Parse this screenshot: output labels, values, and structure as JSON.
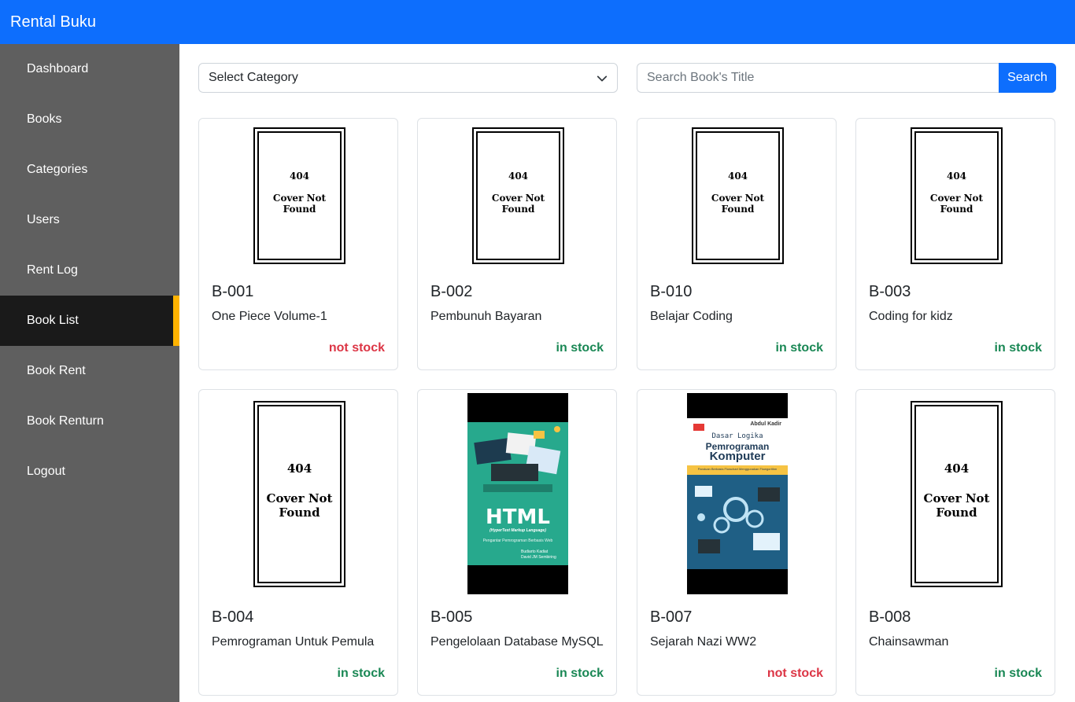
{
  "app": {
    "brand": "Rental Buku"
  },
  "sidebar": {
    "items": [
      {
        "label": "Dashboard"
      },
      {
        "label": "Books"
      },
      {
        "label": "Categories"
      },
      {
        "label": "Users"
      },
      {
        "label": "Rent Log"
      },
      {
        "label": "Book List",
        "active": true
      },
      {
        "label": "Book Rent"
      },
      {
        "label": "Book Renturn"
      },
      {
        "label": "Logout"
      }
    ]
  },
  "filters": {
    "category_selected": "Select Category",
    "search_placeholder": "Search Book's Title",
    "search_button": "Search"
  },
  "cover_placeholder": {
    "code": "404",
    "line1": "Cover Not",
    "line2": "Found"
  },
  "books": [
    {
      "code": "B-001",
      "title": "One Piece Volume-1",
      "status": "not stock"
    },
    {
      "code": "B-002",
      "title": "Pembunuh Bayaran",
      "status": "in stock"
    },
    {
      "code": "B-010",
      "title": "Belajar Coding",
      "status": "in stock"
    },
    {
      "code": "B-003",
      "title": "Coding for kidz",
      "status": "in stock"
    },
    {
      "code": "B-004",
      "title": "Pemrograman Untuk Pemula",
      "status": "in stock"
    },
    {
      "code": "B-005",
      "title": "Pengelolaan Database MySQL",
      "status": "in stock"
    },
    {
      "code": "B-007",
      "title": "Sejarah Nazi WW2",
      "status": "not stock"
    },
    {
      "code": "B-008",
      "title": "Chainsawman",
      "status": "in stock"
    }
  ],
  "cover_html": {
    "big": "HTML",
    "subtitle": "(HyperText Markup Language)",
    "tagline": "Pengantar Pemrograman Berbasis Web",
    "author1": "Budiarto Kadiat",
    "author2": "David JM Sembiring"
  },
  "cover_komputer": {
    "author": "Abdul Kadir",
    "line1": "Dasar Logika",
    "line2": "Pemrograman",
    "line3": "Komputer",
    "tagline": "Panduan Berbasis Flowchart Menggunakan Flowgorithm"
  },
  "colors": {
    "primary": "#0d6efd",
    "sidebar": "#5f5f5f",
    "sidebar_active": "#1a1a1a",
    "active_indicator": "#ffb300",
    "in_stock": "#198754",
    "not_stock": "#dc3545"
  }
}
